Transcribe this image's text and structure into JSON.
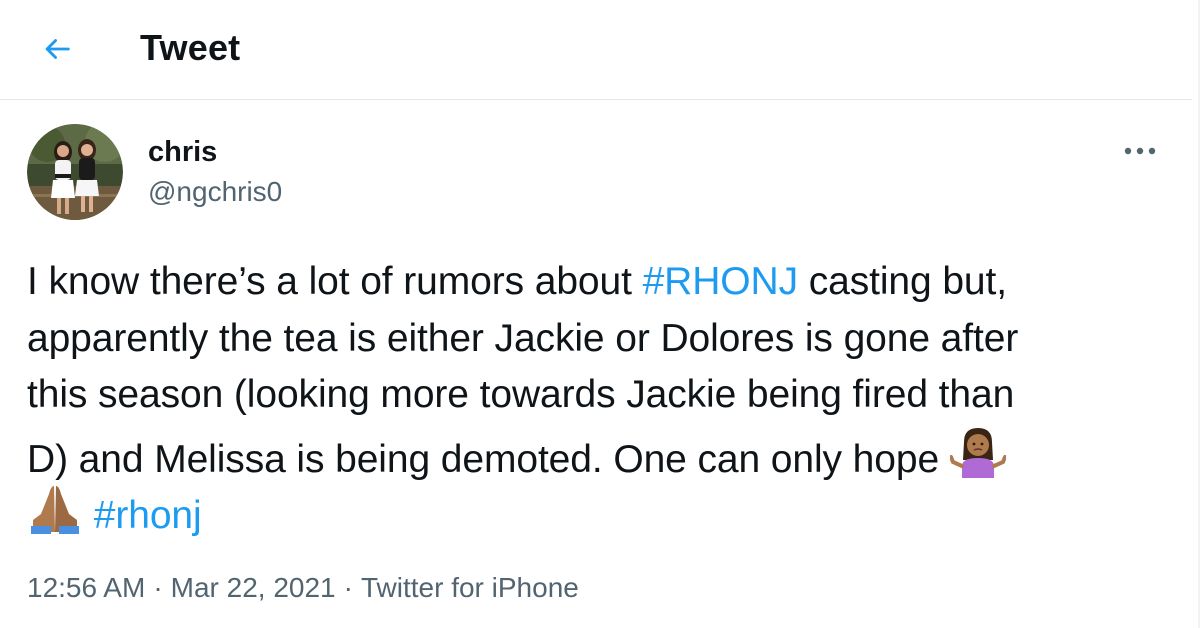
{
  "header": {
    "back_icon": "arrow-left-icon",
    "title": "Tweet"
  },
  "author": {
    "avatar_icon": "profile-photo",
    "name": "chris",
    "handle": "@ngchris0",
    "more_icon": "more-horizontal-icon"
  },
  "tweet": {
    "line1_before": "I know there’s a lot of rumors about ",
    "hashtag1": "#RHONJ",
    "line1_after": " casting but,",
    "line2": "apparently the tea is either Jackie or Dolores is gone after",
    "line3": "this season (looking more towards Jackie being fired than",
    "line4": "D) and Melissa is being demoted. One can only hope ",
    "emoji1": "shrugging-woman-emoji",
    "emoji2": "folded-hands-emoji",
    "hashtag2": "#rhonj"
  },
  "meta": {
    "time": "12:56 AM",
    "separator": "·",
    "date": "Mar 22, 2021",
    "source": "Twitter for iPhone"
  },
  "colors": {
    "accent": "#1d9bf0",
    "text": "#0f1419",
    "secondary": "#536471",
    "border": "#e1e8ed"
  }
}
